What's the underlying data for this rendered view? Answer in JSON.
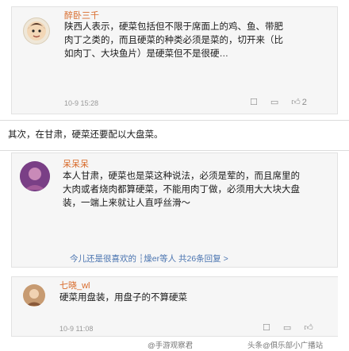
{
  "comment1": {
    "name": "醉卧三千",
    "text": "陕西人表示，硬菜包括但不限于席面上的鸡、鱼、带肥肉丁之类的，而且硬菜的种类必须是菜的，切开来（比如肉丁、大块鱼片）是硬菜但不是很硬…",
    "time": "10-9 15:28",
    "likes": "2"
  },
  "reply_section": {
    "text": "其次，在甘肃，硬菜还要配以大盘菜。"
  },
  "comment2": {
    "name": "呆呆呆",
    "text": "本人甘肃，硬菜也是菜这种说法，必须是荤的，而且席里的大肉或者烧肉都算硬菜，不能用肉丁做，必须用大大块大盘装，一端上来就让人直呼丝滑～",
    "more_replies": "今儿还是很喜欢的 ┆燥er等人 共26条回复 >"
  },
  "comment3": {
    "name": "七晓_wl",
    "text": "硬菜用盘装，用盘子的不算硬菜",
    "time": "10-9 11:08"
  },
  "watermark": {
    "left": "@手游观察君",
    "right": "头条@俱乐部小广播站"
  },
  "colors": {
    "username": "#d86a2a",
    "accent_link": "#4a74b0"
  }
}
